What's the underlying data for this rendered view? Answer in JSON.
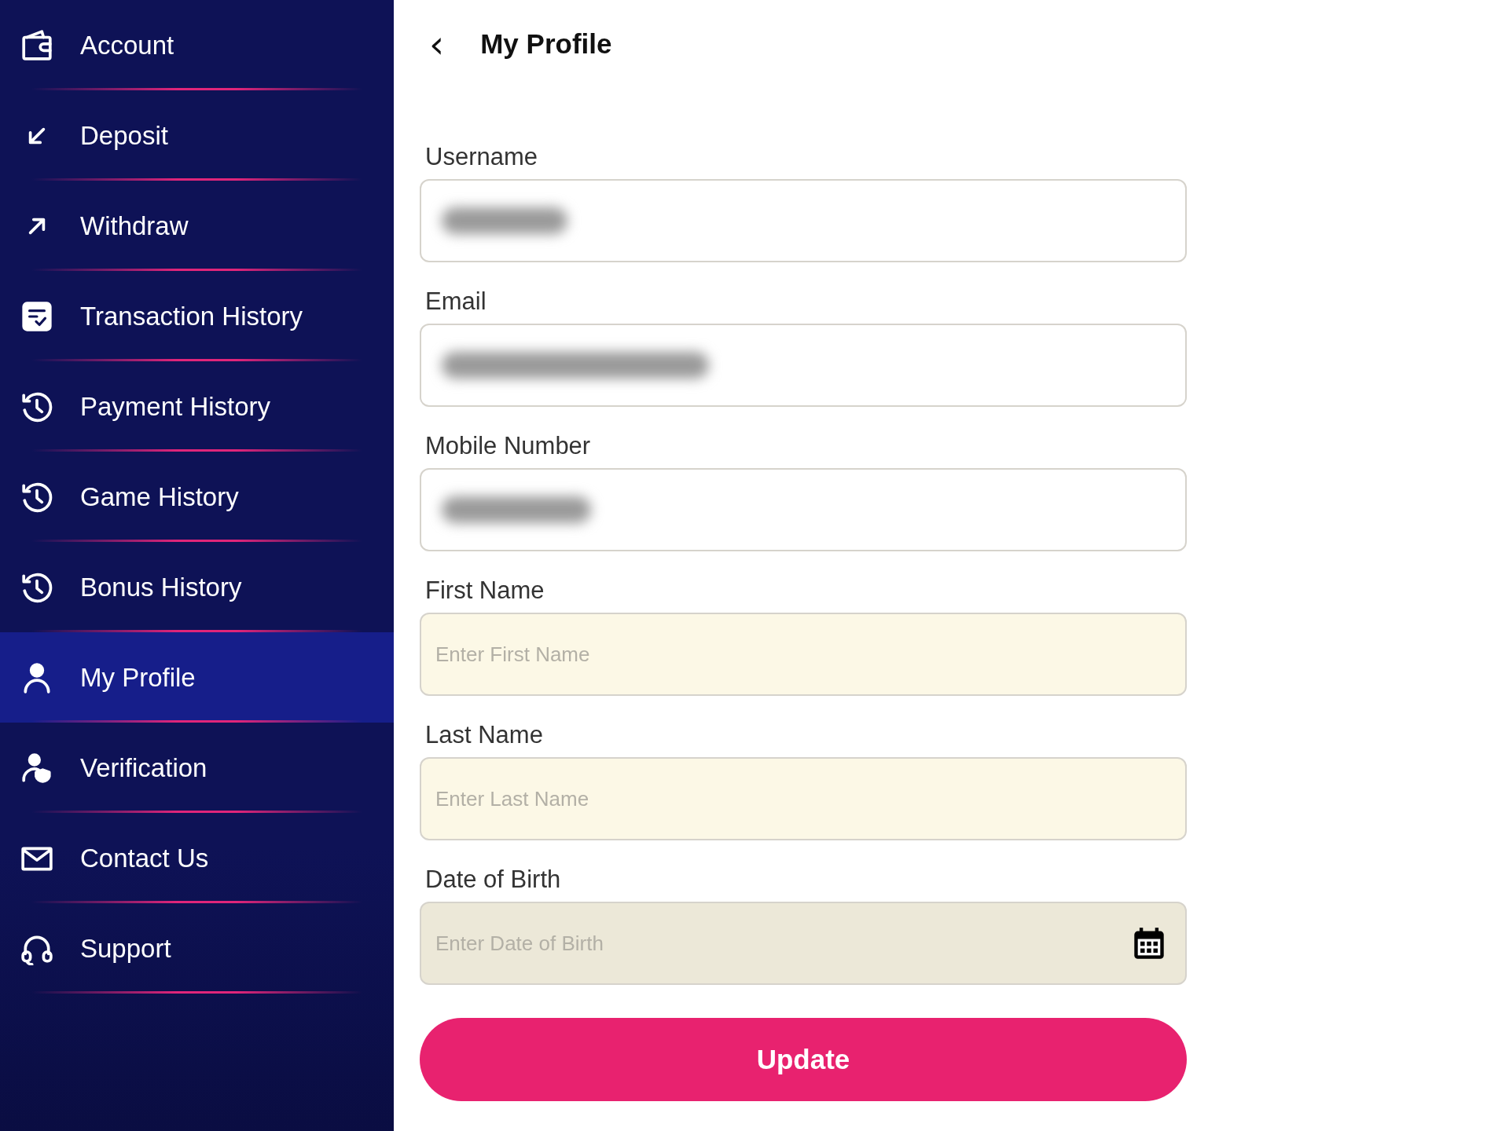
{
  "sidebar": {
    "items": [
      {
        "label": "Account",
        "selected": false
      },
      {
        "label": "Deposit",
        "selected": false
      },
      {
        "label": "Withdraw",
        "selected": false
      },
      {
        "label": "Transaction History",
        "selected": false
      },
      {
        "label": "Payment History",
        "selected": false
      },
      {
        "label": "Game History",
        "selected": false
      },
      {
        "label": "Bonus History",
        "selected": false
      },
      {
        "label": "My Profile",
        "selected": true
      },
      {
        "label": "Verification",
        "selected": false
      },
      {
        "label": "Contact Us",
        "selected": false
      },
      {
        "label": "Support",
        "selected": false
      }
    ]
  },
  "header": {
    "back": "‹",
    "title": "My Profile"
  },
  "form": {
    "fields": [
      {
        "label": "Username",
        "kind": "redacted"
      },
      {
        "label": "Email",
        "kind": "redacted"
      },
      {
        "label": "Mobile Number",
        "kind": "redacted"
      },
      {
        "label": "First Name",
        "kind": "text",
        "placeholder": "Enter First Name"
      },
      {
        "label": "Last Name",
        "kind": "text",
        "placeholder": "Enter Last Name"
      },
      {
        "label": "Date of Birth",
        "kind": "date",
        "placeholder": "Enter Date of Birth"
      }
    ],
    "submit": "Update"
  }
}
